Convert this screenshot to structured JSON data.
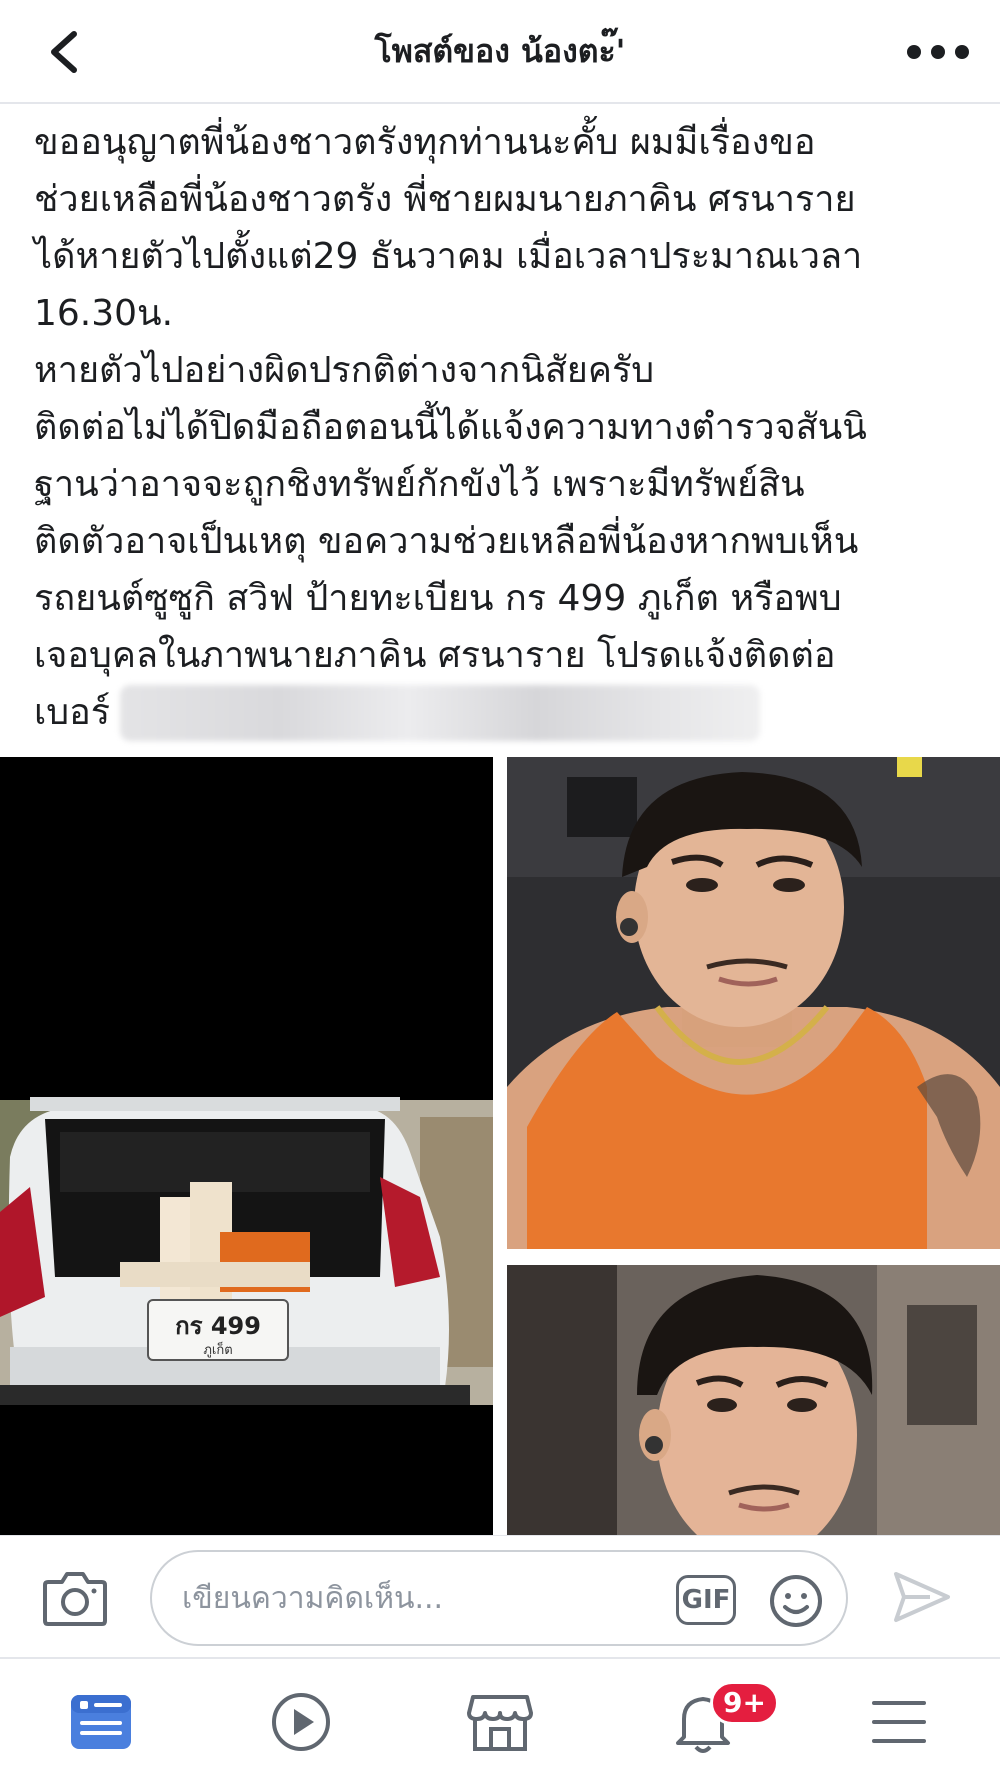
{
  "header": {
    "title": "โพสต์ของ น้องตะ๊'",
    "back_icon": "chevron-left-icon",
    "more_icon": "more-horizontal-icon"
  },
  "post": {
    "lines": [
      "ขออนุญาตพี่น้องชาวตรังทุกท่านนะคั้บ ผมมีเรื่องขอ",
      "ช่วยเหลือพี่น้องชาวตรัง พี่ชายผมนายภาคิน ศรนาราย",
      "ได้หายตัวไปตั้งแต่29 ธันวาคม เมื่อเวลาประมาณเวลา",
      "16.30น.",
      "หายตัวไปอย่างผิดปรกติต่างจากนิสัยครับ",
      "ติดต่อไม่ได้ปิดมือถือตอนนี้ได้แจ้งความทางตำรวจสันนิ",
      "ฐานว่าอาจจะถูกชิงทรัพย์กักขังไว้ เพราะมีทรัพย์สิน",
      "ติดตัวอาจเป็นเหตุ ขอความช่วยเหลือพี่น้องหากพบเห็น",
      "รถยนต์ซูซูกิ สวิฟ ป้ายทะเบียน กร 499 ภูเก็ต หรือพบ",
      "เจอบุคลในภาพนายภาคิน ศรนาราย โปรดแจ้งติดต่อ"
    ],
    "phone_prefix": "เบอร์"
  },
  "photos": {
    "car_plate_main": "กร  499",
    "car_plate_sub": "ภูเก็ต"
  },
  "comment_bar": {
    "placeholder": "เขียนความคิดเห็น...",
    "gif_label": "GIF",
    "camera_icon": "camera-icon",
    "emoji_icon": "smiley-icon",
    "send_icon": "send-icon"
  },
  "bottom_nav": {
    "items": [
      {
        "icon": "news-feed-icon",
        "active": true
      },
      {
        "icon": "watch-play-icon",
        "active": false
      },
      {
        "icon": "marketplace-shop-icon",
        "active": false
      },
      {
        "icon": "notifications-bell-icon",
        "active": false
      },
      {
        "icon": "menu-hamburger-icon",
        "active": false
      }
    ],
    "notification_badge": "9+"
  },
  "colors": {
    "accent": "#4a7fde",
    "icon_gray": "#606770",
    "badge_red": "#e41e3f",
    "divider": "#e4e6eb",
    "shirt_orange": "#e8782e"
  }
}
